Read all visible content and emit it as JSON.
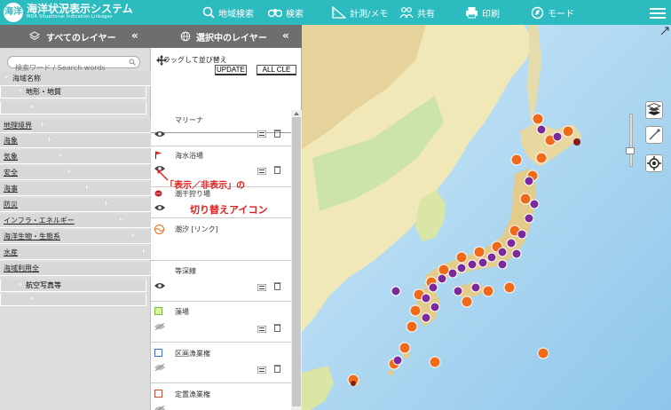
{
  "header": {
    "logo_text": "海洋",
    "title": "海洋状況表示システム",
    "subtitle": "MDA Situational Indication Linkages",
    "tools": [
      {
        "label": "地域検索",
        "icon": "search-icon"
      },
      {
        "label": "検索",
        "icon": "binoculars-icon"
      },
      {
        "label": "計測/メモ",
        "icon": "ruler-icon"
      },
      {
        "label": "共有",
        "icon": "share-icon"
      },
      {
        "label": "印刷",
        "icon": "printer-icon"
      },
      {
        "label": "モード",
        "icon": "mode-icon"
      }
    ]
  },
  "left_panel": {
    "title": "すべてのレイヤー",
    "collapse": "«",
    "search_placeholder": "検索ワード / Search words",
    "categories": [
      {
        "label": "海域名称",
        "expander": "+"
      },
      {
        "label": "地形・地質",
        "expander": "+"
      },
      {
        "label": "",
        "expander": "+"
      },
      {
        "label": "地理境界",
        "expander": "+"
      },
      {
        "label": "海象",
        "expander": "+"
      },
      {
        "label": "気象",
        "expander": "+"
      },
      {
        "label": "安全",
        "expander": "+"
      },
      {
        "label": "海事",
        "expander": "+"
      },
      {
        "label": "防災",
        "expander": "+"
      },
      {
        "label": "インフラ・エネルギー",
        "expander": "+"
      },
      {
        "label": "海洋生物・生態系",
        "expander": "+"
      },
      {
        "label": "水産",
        "expander": "+"
      },
      {
        "label": "海域利用全",
        "expander": ""
      },
      {
        "label": "航空写真等",
        "expander": "+"
      },
      {
        "label": "",
        "expander": "+"
      }
    ]
  },
  "mid_panel": {
    "title": "選択中のレイヤー",
    "collapse": "«",
    "drag_hint": "ドラッグして並び替え",
    "update_label": "UPDATE",
    "allclear_label": "ALL CLE",
    "layers": [
      {
        "name": "マリーナ"
      },
      {
        "name": "海水浴場"
      },
      {
        "name": "潮干狩り場"
      },
      {
        "name": "潮汐 [リンク]"
      },
      {
        "name": "等深線"
      },
      {
        "name": "藻場"
      },
      {
        "name": "区画漁業権"
      },
      {
        "name": "定置漁業権"
      }
    ]
  },
  "annotation": {
    "line1": "「表示／非表示」の",
    "line2": "切り替えアイコン"
  },
  "colors": {
    "header": "#2cbcc0",
    "panel_head": "#6e6e6e",
    "annotation": "#e02020",
    "sea": "#b9dff4",
    "land": "#f3ecc0",
    "marker_orange": "#f06a1a",
    "marker_purple": "#7a2a9a"
  }
}
